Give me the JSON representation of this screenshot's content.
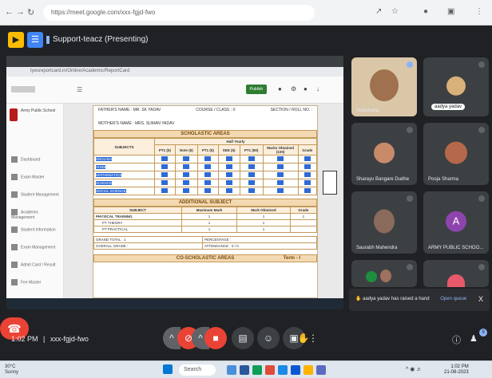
{
  "browser": {
    "url": "https://meet.google.com/xxx-fgjd-fwo",
    "nav_icons": [
      "back-icon",
      "forward-icon",
      "reload-icon"
    ],
    "toolbar_icons": [
      "share-icon",
      "star-icon",
      "profile-icon",
      "extensions-icon",
      "menu-icon"
    ]
  },
  "meet_top": {
    "presenting_label": "Support-teacz (Presenting)"
  },
  "shared_screen": {
    "inner_url": "tyesreportcard.in/Online/Academic/ReportCard",
    "school_name": "Army Public School",
    "publish_button": "Publish",
    "sidebar_items": [
      "Dashboard",
      "Exam Master",
      "Student Management",
      "Academic Management",
      "Student Information",
      "Exam Management",
      "Admit Card / Result",
      "Fee Master"
    ],
    "father_name": "FATHER'S NAME : MR. SK YADAV",
    "class_line": "COURSE / CLASS : X",
    "section_line": "SECTION / ROLL NO. : ",
    "mother_name": "MOTHER'S NAME : MRS. SUMAN YADAV",
    "scholastic_band": "SCHOLASTIC AREAS",
    "half_yearly": "Half Yearly",
    "subjects_header": "SUBJECTS",
    "columns": [
      "PT1 (5)",
      "Note (5)",
      "PT1 (5)",
      "SEE (5)",
      "PT1 (80)",
      "Marks Obtained (100)",
      "Grade"
    ],
    "subjects": [
      "ENGLISH",
      "HINDI",
      "MATHEMATICS",
      "SCIENCE",
      "SOCIAL SCIENCE"
    ],
    "additional_band": "ADDITIONAL SUBJECT",
    "additional_cols": [
      "SUBJECT",
      "Maximum Mark",
      "Mark Obtained",
      "Grade"
    ],
    "additional_rows": [
      {
        "name": "PHYSICAL TRAINING",
        "max": "1",
        "obt": "1",
        "grade": "1"
      },
      {
        "name": "PT THEORY",
        "max": "1",
        "obt": "1",
        "grade": ""
      },
      {
        "name": "PT PRACTICAL",
        "max": "1",
        "obt": "1",
        "grade": ""
      }
    ],
    "grand_total": "GRAND TOTAL : 1",
    "percentage": "PERCENTAGE :",
    "overall_grade": "OVERALL GRADE :",
    "attendance": "ATTENDANCE : 0 / 0",
    "co_scholastic_band": "CO-SCHOLASTIC AREAS",
    "term_label": "Term - I"
  },
  "participants": [
    {
      "name": "Sulochana",
      "initial": ""
    },
    {
      "name": "aadya yadav",
      "initial": ""
    },
    {
      "name": "Sharayu Bangare Dudhe",
      "initial": ""
    },
    {
      "name": "Pooja Sharma",
      "initial": ""
    },
    {
      "name": "Saurabh Mahendra",
      "initial": ""
    },
    {
      "name": "ARMY PUBLIC SCHOO...",
      "initial": "A"
    },
    {
      "name": "",
      "initial": ""
    },
    {
      "name": "",
      "initial": ""
    }
  ],
  "toast": {
    "text": "aadya yadav has raised a hand",
    "link": "Open queue",
    "close": "X"
  },
  "meeting_info": {
    "time": "1:02 PM",
    "code": "xxx-fgjd-fwo"
  },
  "controls": [
    "mic-off-icon",
    "camera-off-icon",
    "captions-icon",
    "emoji-icon",
    "present-icon",
    "raise-hand-icon",
    "more-icon"
  ],
  "taskbar": {
    "weather_temp": "30°C",
    "weather_desc": "Sunny",
    "search_label": "Search",
    "time": "1:02 PM",
    "date": "21-08-2023"
  }
}
